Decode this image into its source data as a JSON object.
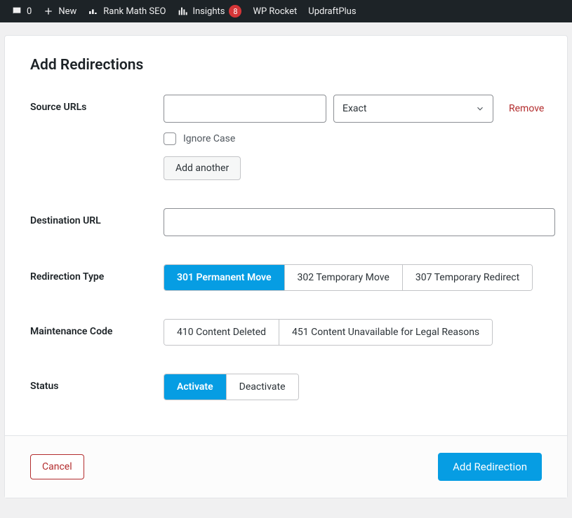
{
  "adminBar": {
    "comments": "0",
    "new": "New",
    "rankMath": "Rank Math SEO",
    "insights": "Insights",
    "insightsBadge": "8",
    "wpRocket": "WP Rocket",
    "updraft": "UpdraftPlus"
  },
  "page": {
    "title": "Add Redirections"
  },
  "form": {
    "sourceLabel": "Source URLs",
    "sourceValue": "",
    "matchType": "Exact",
    "removeLabel": "Remove",
    "ignoreCaseLabel": "Ignore Case",
    "addAnotherLabel": "Add another",
    "destLabel": "Destination URL",
    "destValue": "",
    "redirTypeLabel": "Redirection Type",
    "redirTypes": {
      "r301": "301 Permanent Move",
      "r302": "302 Temporary Move",
      "r307": "307 Temporary Redirect"
    },
    "maintLabel": "Maintenance Code",
    "maintCodes": {
      "c410": "410 Content Deleted",
      "c451": "451 Content Unavailable for Legal Reasons"
    },
    "statusLabel": "Status",
    "status": {
      "activate": "Activate",
      "deactivate": "Deactivate"
    }
  },
  "footer": {
    "cancel": "Cancel",
    "submit": "Add Redirection"
  }
}
